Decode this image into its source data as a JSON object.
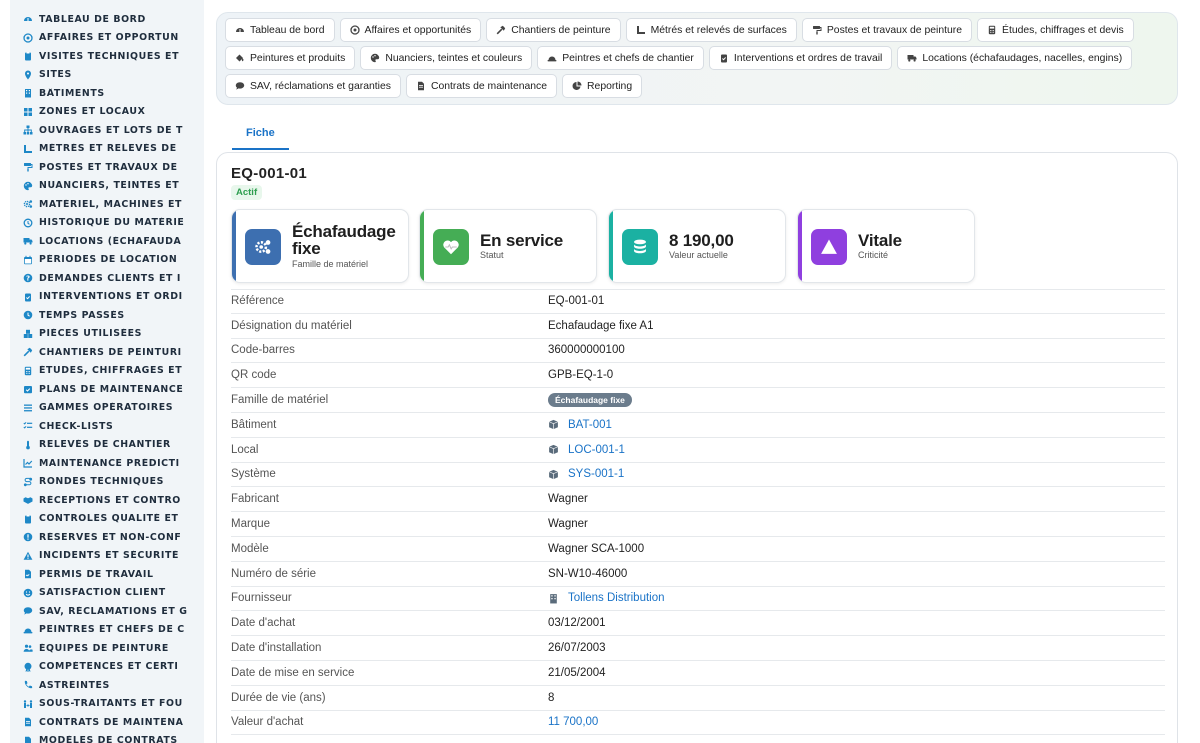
{
  "sidebar": {
    "items": [
      {
        "label": "TABLEAU DE BORD",
        "icon": "dashboard-icon"
      },
      {
        "label": "AFFAIRES ET OPPORTUN",
        "icon": "target-icon"
      },
      {
        "label": "VISITES TECHNIQUES ET",
        "icon": "clipboard-icon"
      },
      {
        "label": "SITES",
        "icon": "map-pin-icon"
      },
      {
        "label": "BÂTIMENTS",
        "icon": "building-icon"
      },
      {
        "label": "ZONES ET LOCAUX",
        "icon": "grid-icon"
      },
      {
        "label": "OUVRAGES ET LOTS DE T",
        "icon": "sitemap-icon"
      },
      {
        "label": "MÉTRÉS ET RELEVÉS DE",
        "icon": "ruler-icon"
      },
      {
        "label": "POSTES ET TRAVAUX DE",
        "icon": "paint-roller-icon"
      },
      {
        "label": "NUANCIERS, TEINTES ET",
        "icon": "palette-icon"
      },
      {
        "label": "MATÉRIEL, MACHINES ET",
        "icon": "gears-icon"
      },
      {
        "label": "HISTORIQUE DU MATÉRIE",
        "icon": "history-icon"
      },
      {
        "label": "LOCATIONS (ÉCHAFAUDA",
        "icon": "truck-icon"
      },
      {
        "label": "PÉRIODES DE LOCATION",
        "icon": "calendar-icon"
      },
      {
        "label": "DEMANDES CLIENTS ET I",
        "icon": "question-icon"
      },
      {
        "label": "INTERVENTIONS ET ORDI",
        "icon": "clipboard-check-icon"
      },
      {
        "label": "TEMPS PASSÉS",
        "icon": "clock-icon"
      },
      {
        "label": "PIÈCES UTILISÉES",
        "icon": "boxes-icon"
      },
      {
        "label": "CHANTIERS DE PEINTURI",
        "icon": "hammer-icon"
      },
      {
        "label": "ÉTUDES, CHIFFRAGES ET",
        "icon": "calculator-icon"
      },
      {
        "label": "PLANS DE MAINTENANCE",
        "icon": "calendar-check-icon"
      },
      {
        "label": "GAMMES OPÉRATOIRES",
        "icon": "list-icon"
      },
      {
        "label": "CHECK-LISTS",
        "icon": "checklist-icon"
      },
      {
        "label": "RELEVÉS DE CHANTIER",
        "icon": "thermometer-icon"
      },
      {
        "label": "MAINTENANCE PRÉDICTI",
        "icon": "chart-line-icon"
      },
      {
        "label": "RONDES TECHNIQUES",
        "icon": "route-icon"
      },
      {
        "label": "RÉCEPTIONS ET CONTRÔ",
        "icon": "handshake-icon"
      },
      {
        "label": "CONTRÔLES QUALITÉ ET",
        "icon": "clipboard-icon"
      },
      {
        "label": "RÉSERVES ET NON-CONF",
        "icon": "alert-circle-icon"
      },
      {
        "label": "INCIDENTS ET SÉCURITÉ",
        "icon": "warning-icon"
      },
      {
        "label": "PERMIS DE TRAVAIL",
        "icon": "file-signature-icon"
      },
      {
        "label": "SATISFACTION CLIENT",
        "icon": "smile-icon"
      },
      {
        "label": "SAV, RÉCLAMATIONS ET G",
        "icon": "comment-icon"
      },
      {
        "label": "PEINTRES ET CHEFS DE C",
        "icon": "hard-hat-icon"
      },
      {
        "label": "ÉQUIPES DE PEINTURE",
        "icon": "users-icon"
      },
      {
        "label": "COMPÉTENCES ET CERTI",
        "icon": "certificate-icon"
      },
      {
        "label": "ASTREINTES",
        "icon": "phone-icon"
      },
      {
        "label": "SOUS-TRAITANTS ET FOU",
        "icon": "people-arrows-icon"
      },
      {
        "label": "CONTRATS DE MAINTENA",
        "icon": "file-contract-icon"
      },
      {
        "label": "MODÈLES DE CONTRATS",
        "icon": "file-icon"
      }
    ]
  },
  "topnav": {
    "row1": [
      {
        "label": "Tableau de bord",
        "icon": "dashboard-icon"
      },
      {
        "label": "Affaires et opportunités",
        "icon": "target-icon"
      },
      {
        "label": "Chantiers de peinture",
        "icon": "hammer-icon"
      },
      {
        "label": "Métrés et relevés de surfaces",
        "icon": "ruler-icon"
      },
      {
        "label": "Postes et travaux de peinture",
        "icon": "paint-roller-icon"
      },
      {
        "label": "Études, chiffrages et devis",
        "icon": "calculator-icon"
      }
    ],
    "row2": [
      {
        "label": "Peintures et produits",
        "icon": "fill-drip-icon"
      },
      {
        "label": "Nuanciers, teintes et couleurs",
        "icon": "palette-icon"
      },
      {
        "label": "Peintres et chefs de chantier",
        "icon": "hard-hat-icon"
      },
      {
        "label": "Interventions et ordres de travail",
        "icon": "clipboard-check-icon"
      },
      {
        "label": "Locations (échafaudages, nacelles, engins)",
        "icon": "truck-icon"
      }
    ],
    "row3": [
      {
        "label": "SAV, réclamations et garanties",
        "icon": "comment-icon"
      },
      {
        "label": "Contrats de maintenance",
        "icon": "file-contract-icon"
      },
      {
        "label": "Reporting",
        "icon": "chart-pie-icon"
      }
    ]
  },
  "tabs": {
    "fiche": "Fiche"
  },
  "record": {
    "title": "EQ-001-01",
    "status_badge": "Actif"
  },
  "kpis": [
    {
      "value": "Échafaudage fixe",
      "label": "Famille de matériel",
      "color": "#3d6fb0",
      "icon": "gears-icon"
    },
    {
      "value": "En service",
      "label": "Statut",
      "color": "#45ad55",
      "icon": "heartbeat-icon"
    },
    {
      "value": "8 190,00",
      "label": "Valeur actuelle",
      "color": "#1bb1a2",
      "icon": "coins-icon"
    },
    {
      "value": "Vitale",
      "label": "Criticité",
      "color": "#8f3fdf",
      "icon": "warning-icon"
    }
  ],
  "fields": [
    {
      "label": "Référence",
      "value": "EQ-001-01",
      "type": "text"
    },
    {
      "label": "Désignation du matériel",
      "value": "Echafaudage fixe A1",
      "type": "text"
    },
    {
      "label": "Code-barres",
      "value": "360000000100",
      "type": "text"
    },
    {
      "label": "QR code",
      "value": "GPB-EQ-1-0",
      "type": "text"
    },
    {
      "label": "Famille de matériel",
      "value": "Échafaudage fixe",
      "type": "chip"
    },
    {
      "label": "Bâtiment",
      "value": "BAT-001",
      "type": "link",
      "icon": "box-icon"
    },
    {
      "label": "Local",
      "value": "LOC-001-1",
      "type": "link",
      "icon": "box-icon"
    },
    {
      "label": "Système",
      "value": "SYS-001-1",
      "type": "link",
      "icon": "box-icon"
    },
    {
      "label": "Fabricant",
      "value": "Wagner",
      "type": "text"
    },
    {
      "label": "Marque",
      "value": "Wagner",
      "type": "text"
    },
    {
      "label": "Modèle",
      "value": "Wagner SCA-1000",
      "type": "text"
    },
    {
      "label": "Numéro de série",
      "value": "SN-W10-46000",
      "type": "text"
    },
    {
      "label": "Fournisseur",
      "value": "Tollens Distribution",
      "type": "link",
      "icon": "building-icon"
    },
    {
      "label": "Date d'achat",
      "value": "03/12/2001",
      "type": "text"
    },
    {
      "label": "Date d'installation",
      "value": "26/07/2003",
      "type": "text"
    },
    {
      "label": "Date de mise en service",
      "value": "21/05/2004",
      "type": "text"
    },
    {
      "label": "Durée de vie (ans)",
      "value": "8",
      "type": "text"
    },
    {
      "label": "Valeur d'achat",
      "value": "11 700,00",
      "type": "link"
    }
  ],
  "colors": {
    "accent": "#1a73c7",
    "sidebar_bg": "#f1f5f8",
    "sidebar_icon": "#1e88c7"
  }
}
